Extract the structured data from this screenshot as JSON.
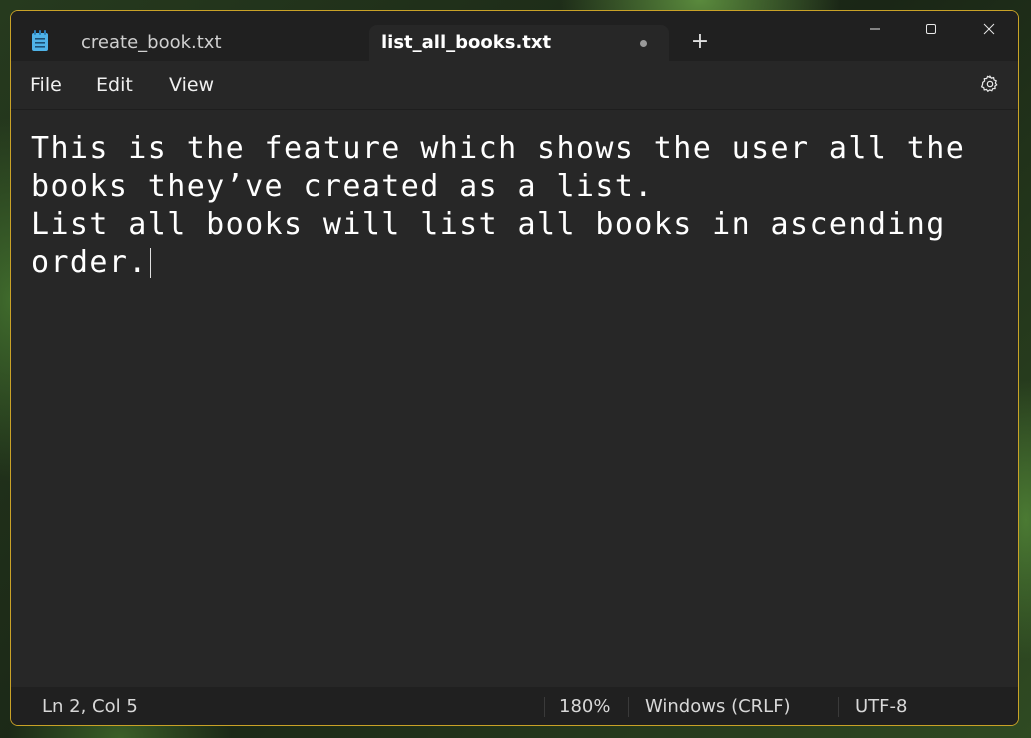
{
  "app": {
    "icon": "notepad-icon"
  },
  "tabs": [
    {
      "label": "create_book.txt",
      "active": false
    },
    {
      "label": "list_all_books.txt",
      "active": true,
      "unsaved": true
    }
  ],
  "window_controls": [
    "minimize-icon",
    "maximize-icon",
    "close-icon"
  ],
  "new_tab_glyph": "+",
  "menu": {
    "file": "File",
    "edit": "Edit",
    "view": "View",
    "settings_icon": "gear-icon"
  },
  "editor": {
    "lines": [
      "This is the feature which shows the user all the",
      "books they’ve created as a list.",
      "List all books will list all books in ascending",
      "order."
    ]
  },
  "status": {
    "position": "Ln 2, Col 5",
    "zoom": "180%",
    "line_ending": "Windows (CRLF)",
    "encoding": "UTF-8"
  },
  "colors": {
    "accent_border": "#c9a227",
    "background": "#272727",
    "chrome": "#202020"
  }
}
